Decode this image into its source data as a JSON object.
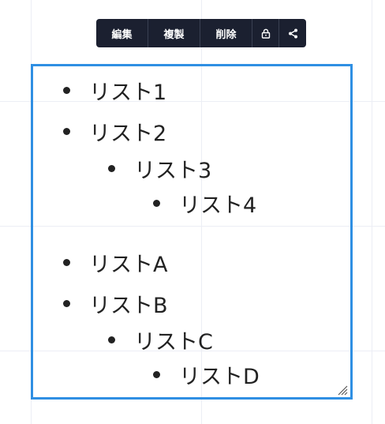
{
  "toolbar": {
    "edit_label": "編集",
    "duplicate_label": "複製",
    "delete_label": "削除",
    "lock_icon": "lock-icon",
    "share_icon": "share-icon"
  },
  "list": {
    "items": [
      {
        "label": "リスト1",
        "level": 1
      },
      {
        "label": "リスト2",
        "level": 1
      },
      {
        "label": "リスト3",
        "level": 2
      },
      {
        "label": "リスト4",
        "level": 3
      },
      {
        "label": "リストA",
        "level": 1
      },
      {
        "label": "リストB",
        "level": 1
      },
      {
        "label": "リストC",
        "level": 2
      },
      {
        "label": "リストD",
        "level": 3
      }
    ]
  },
  "colors": {
    "selection_border": "#2f8fe3",
    "toolbar_bg": "#1b2030",
    "text": "#222222",
    "grid": "#eceef5"
  }
}
